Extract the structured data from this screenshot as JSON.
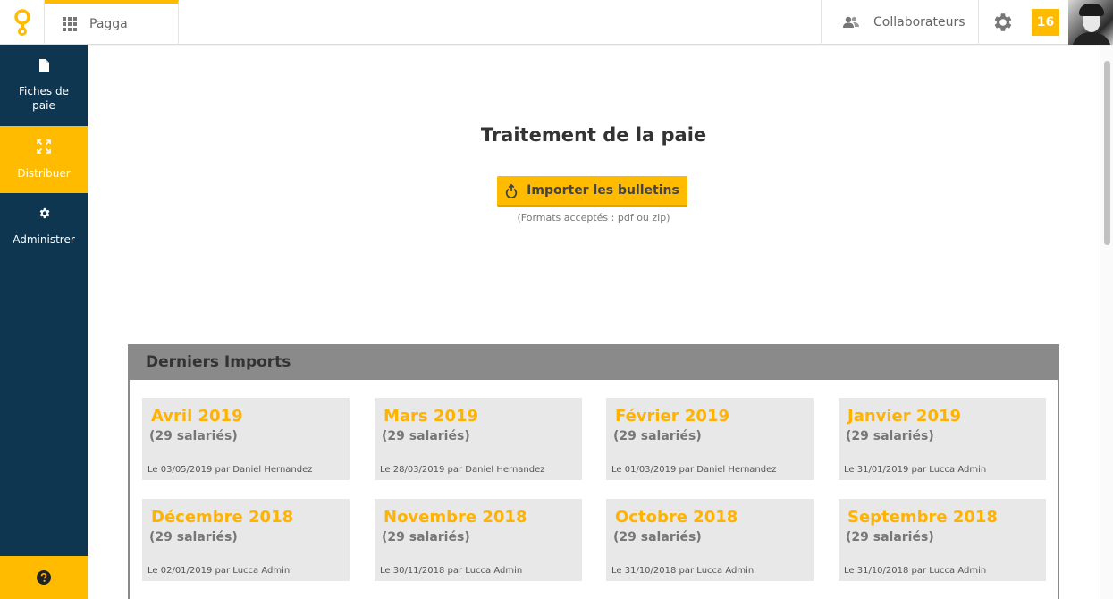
{
  "app": {
    "name": "Pagga"
  },
  "header": {
    "collaborators_label": "Collaborateurs",
    "notification_count": "16"
  },
  "sidebar": {
    "items": [
      {
        "label": "Fiches de paie",
        "icon": "document-icon"
      },
      {
        "label": "Distribuer",
        "icon": "expand-arrows-icon",
        "active": true
      },
      {
        "label": "Administrer",
        "icon": "gear-icon"
      }
    ],
    "help_icon": "help-icon"
  },
  "main": {
    "title": "Traitement de la paie",
    "import_button": "Importer les bulletins",
    "formats_note": "(Formats acceptés : pdf ou zip)"
  },
  "imports": {
    "title": "Derniers Imports",
    "cards": [
      {
        "month": "Avril 2019",
        "count": "(29 salariés)",
        "meta": "Le 03/05/2019 par Daniel Hernandez"
      },
      {
        "month": "Mars 2019",
        "count": "(29 salariés)",
        "meta": "Le 28/03/2019 par Daniel Hernandez"
      },
      {
        "month": "Février 2019",
        "count": "(29 salariés)",
        "meta": "Le 01/03/2019 par Daniel Hernandez"
      },
      {
        "month": "Janvier 2019",
        "count": "(29 salariés)",
        "meta": "Le 31/01/2019 par Lucca Admin"
      },
      {
        "month": "Décembre 2018",
        "count": "(29 salariés)",
        "meta": "Le 02/01/2019 par Lucca Admin"
      },
      {
        "month": "Novembre 2018",
        "count": "(29 salariés)",
        "meta": "Le 30/11/2018 par Lucca Admin"
      },
      {
        "month": "Octobre 2018",
        "count": "(29 salariés)",
        "meta": "Le 31/10/2018 par Lucca Admin"
      },
      {
        "month": "Septembre 2018",
        "count": "(29 salariés)",
        "meta": "Le 31/10/2018 par Lucca Admin"
      }
    ]
  },
  "colors": {
    "accent": "#ffbb00",
    "sidebar_bg": "#0f3650",
    "panel_header": "#8a8a8a",
    "card_bg": "#e8e8e8"
  }
}
